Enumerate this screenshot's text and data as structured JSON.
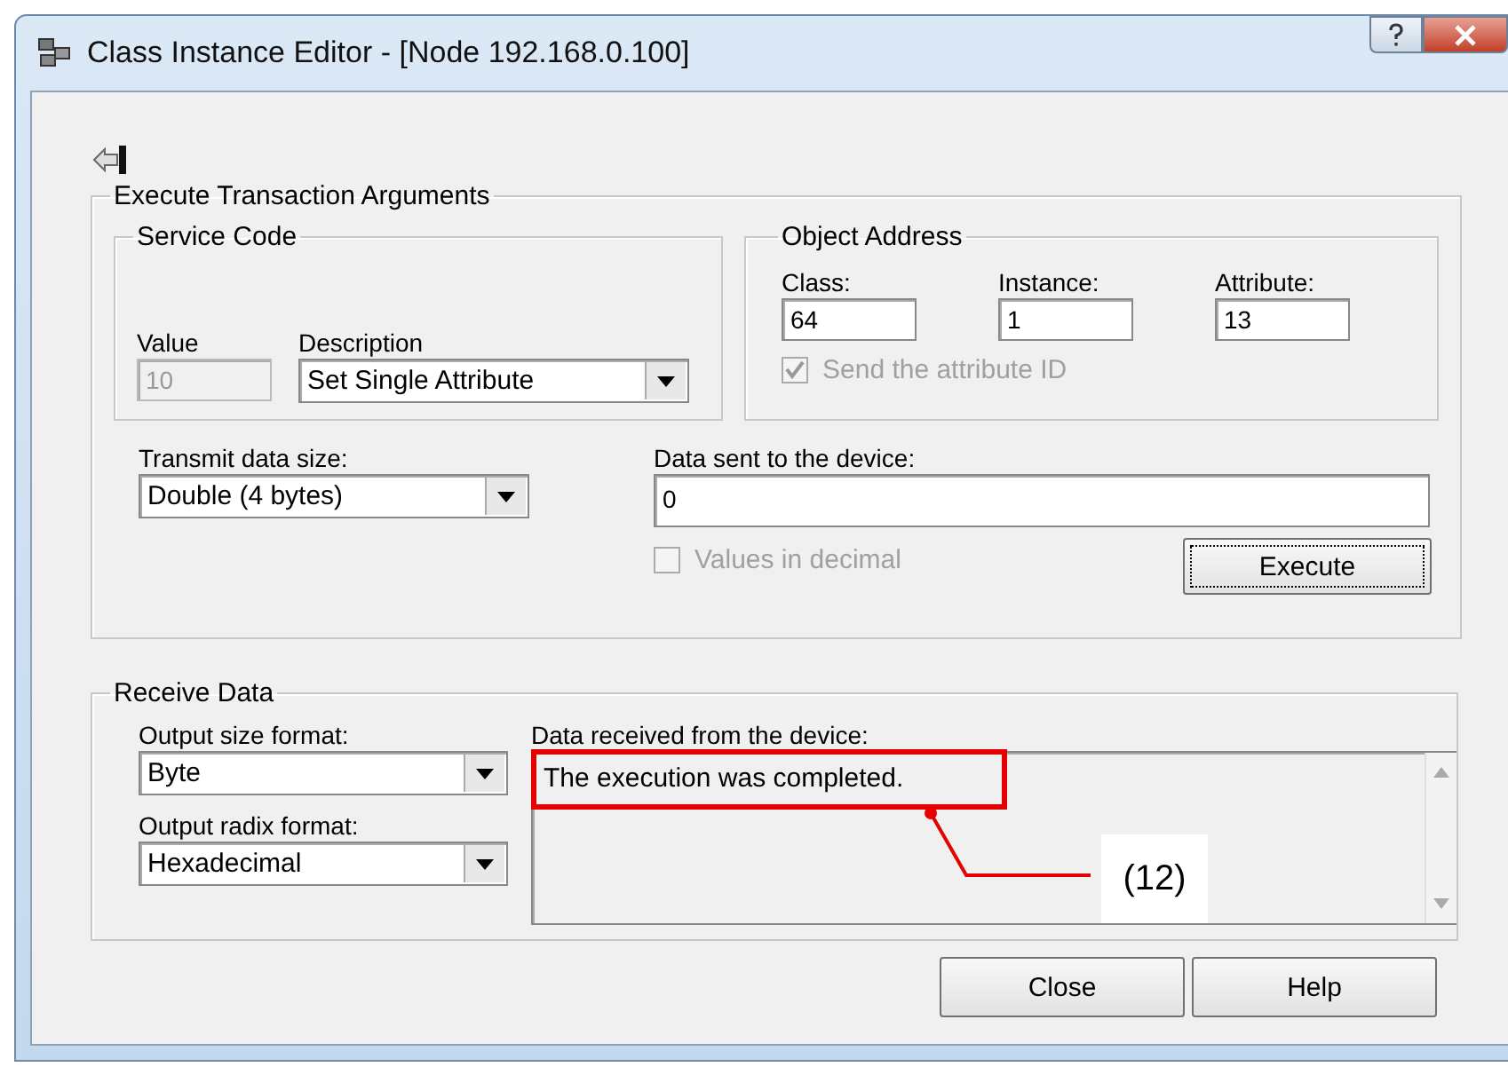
{
  "window": {
    "title": "Class Instance Editor - [Node 192.168.0.100]"
  },
  "transaction": {
    "title": "Execute Transaction Arguments",
    "service_code": {
      "title": "Service Code",
      "value": {
        "label": "Value",
        "value": "10",
        "disabled": true
      },
      "description": {
        "label": "Description",
        "value": "Set Single Attribute"
      }
    },
    "object_address": {
      "title": "Object Address",
      "fields": [
        {
          "label": "Class:",
          "value": "64"
        },
        {
          "label": "Instance:",
          "value": "1"
        },
        {
          "label": "Attribute:",
          "value": "13"
        }
      ],
      "send_attribute_id": {
        "label": "Send the attribute ID",
        "checked": true,
        "disabled": true
      }
    },
    "transmit_size": {
      "label": "Transmit data size:",
      "value": "Double (4 bytes)"
    },
    "data_sent": {
      "label": "Data sent to the device:",
      "value": "0"
    },
    "values_in_decimal": {
      "label": "Values in decimal",
      "checked": false,
      "disabled": true
    },
    "execute_button": "Execute"
  },
  "receive": {
    "title": "Receive Data",
    "output_size": {
      "label": "Output size format:",
      "value": "Byte"
    },
    "output_radix": {
      "label": "Output radix format:",
      "value": "Hexadecimal"
    },
    "data_received": {
      "label": "Data received from the device:",
      "value": "The execution was completed."
    }
  },
  "buttons": [
    "Close",
    "Help"
  ],
  "annotation": {
    "label": "(12)"
  }
}
